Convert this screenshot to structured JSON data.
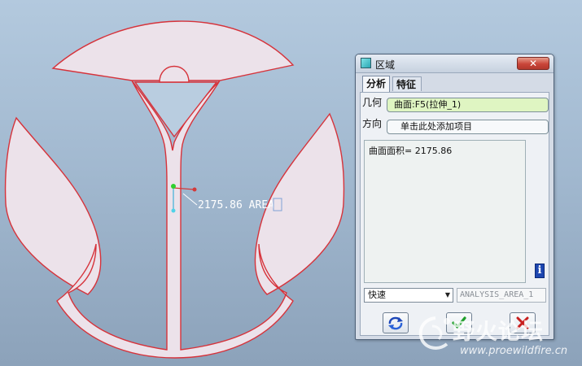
{
  "model": {
    "annotation": "2175.86 AREA",
    "shape_fill": "#ece2ea",
    "shape_edge": "#d6333b"
  },
  "dialog": {
    "title": "区域",
    "close_symbol": "✕",
    "tabs": [
      {
        "label": "分析",
        "active": true
      },
      {
        "label": "特征",
        "active": false
      }
    ],
    "geometry": {
      "label": "几何",
      "value": "曲面:F5(拉伸_1)"
    },
    "direction": {
      "label": "方向",
      "value": "单击此处添加项目"
    },
    "result_text": "曲面面积= 2175.86",
    "info_symbol": "i",
    "speed": {
      "selected": "快速",
      "arrow": "▼"
    },
    "analysis_name": "ANALYSIS_AREA_1",
    "buttons": {
      "repeat": "repeat-icon",
      "ok": "checkmark-icon",
      "cancel": "cross-icon"
    }
  },
  "watermark": {
    "text": "野火论坛",
    "url": "www.proewildfire.cn"
  }
}
